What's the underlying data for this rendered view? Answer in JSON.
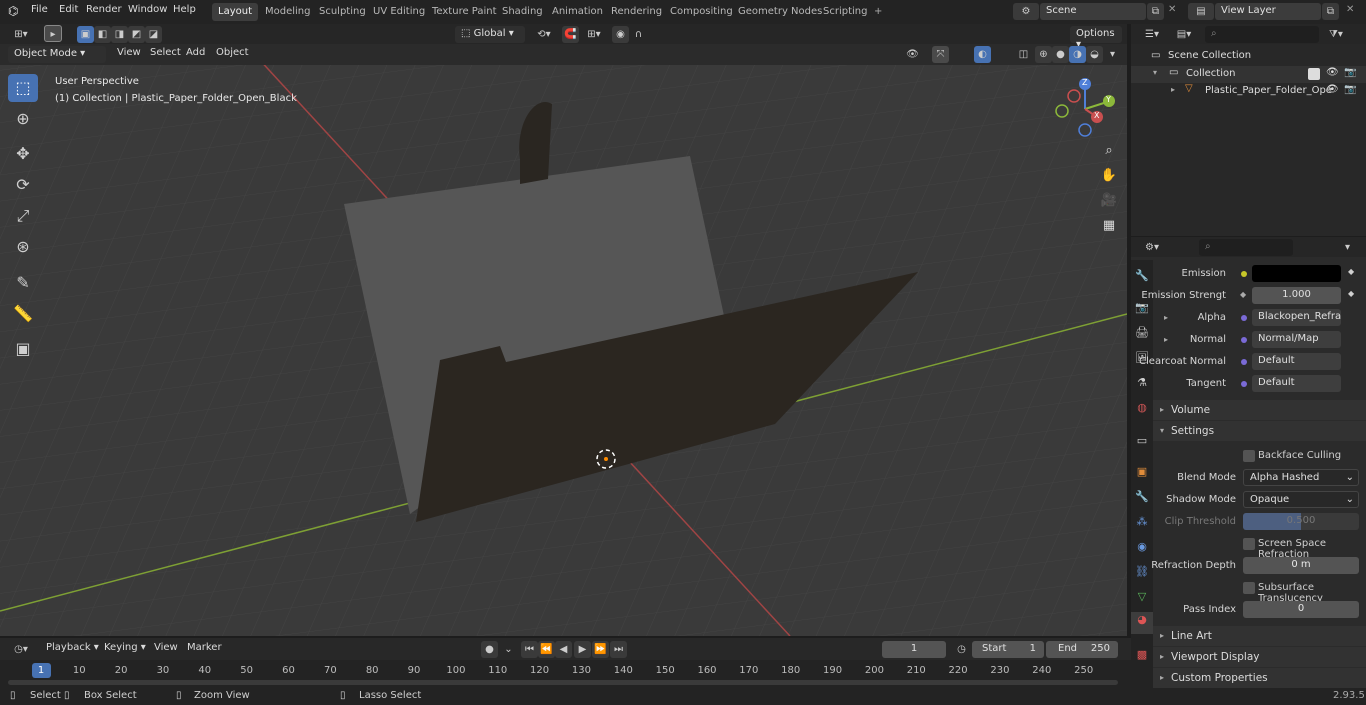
{
  "topbar": {
    "menus": [
      "File",
      "Edit",
      "Render",
      "Window",
      "Help"
    ],
    "workspace_tabs": [
      "Layout",
      "Modeling",
      "Sculpting",
      "UV Editing",
      "Texture Paint",
      "Shading",
      "Animation",
      "Rendering",
      "Compositing",
      "Geometry Nodes",
      "Scripting"
    ],
    "active_tab": "Layout",
    "add_tab": "+",
    "scene": "Scene",
    "view_layer": "View Layer"
  },
  "viewport_header": {
    "mode": "Object Mode",
    "menus": [
      "View",
      "Select",
      "Add",
      "Object"
    ],
    "orientation": "Global",
    "options": "Options"
  },
  "viewport": {
    "perspective": "User Perspective",
    "collection_info": "(1) Collection | Plastic_Paper_Folder_Open_Black",
    "axes": {
      "x": "X",
      "y": "Y",
      "z": "Z"
    }
  },
  "tools": [
    "select-box",
    "cursor",
    "move",
    "rotate",
    "scale",
    "transform",
    "annotate",
    "measure",
    "add-cube"
  ],
  "outliner": {
    "scene_collection": "Scene Collection",
    "collection": "Collection",
    "object": "Plastic_Paper_Folder_Ope"
  },
  "properties": {
    "emission_label": "Emission",
    "emission_color": "#000000",
    "emission_strength_label": "Emission Strengt",
    "emission_strength": "1.000",
    "alpha_label": "Alpha",
    "alpha_value": "Blackopen_Refracti...",
    "normal_label": "Normal",
    "normal_value": "Normal/Map",
    "clearcoat_label": "Clearcoat Normal",
    "clearcoat_value": "Default",
    "tangent_label": "Tangent",
    "tangent_value": "Default",
    "volume": "Volume",
    "settings": "Settings",
    "backface_culling": "Backface Culling",
    "blend_mode_label": "Blend Mode",
    "blend_mode": "Alpha Hashed",
    "shadow_mode_label": "Shadow Mode",
    "shadow_mode": "Opaque",
    "clip_threshold_label": "Clip Threshold",
    "clip_threshold": "0.500",
    "ssr": "Screen Space Refraction",
    "refraction_depth_label": "Refraction Depth",
    "refraction_depth": "0 m",
    "subsurface": "Subsurface Translucency",
    "pass_index_label": "Pass Index",
    "pass_index": "0",
    "line_art": "Line Art",
    "viewport_display": "Viewport Display",
    "custom_properties": "Custom Properties"
  },
  "timeline": {
    "menus": [
      "Playback",
      "Keying",
      "View",
      "Marker"
    ],
    "current_frame": "1",
    "start_label": "Start",
    "start": "1",
    "end_label": "End",
    "end": "250",
    "ticks": [
      "1",
      "10",
      "20",
      "30",
      "40",
      "50",
      "60",
      "70",
      "80",
      "90",
      "100",
      "110",
      "120",
      "130",
      "140",
      "150",
      "160",
      "170",
      "180",
      "190",
      "200",
      "210",
      "220",
      "230",
      "240",
      "250"
    ]
  },
  "statusbar": {
    "select": "Select",
    "box_select": "Box Select",
    "zoom_view": "Zoom View",
    "lasso_select": "Lasso Select",
    "version": "2.93.5"
  },
  "colors": {
    "accent": "#4772b3",
    "x_axis": "#c94f4f",
    "y_axis": "#8cb83a",
    "z_axis": "#4f7fd9",
    "folder_back": "#555555",
    "folder_front": "#28241f"
  }
}
